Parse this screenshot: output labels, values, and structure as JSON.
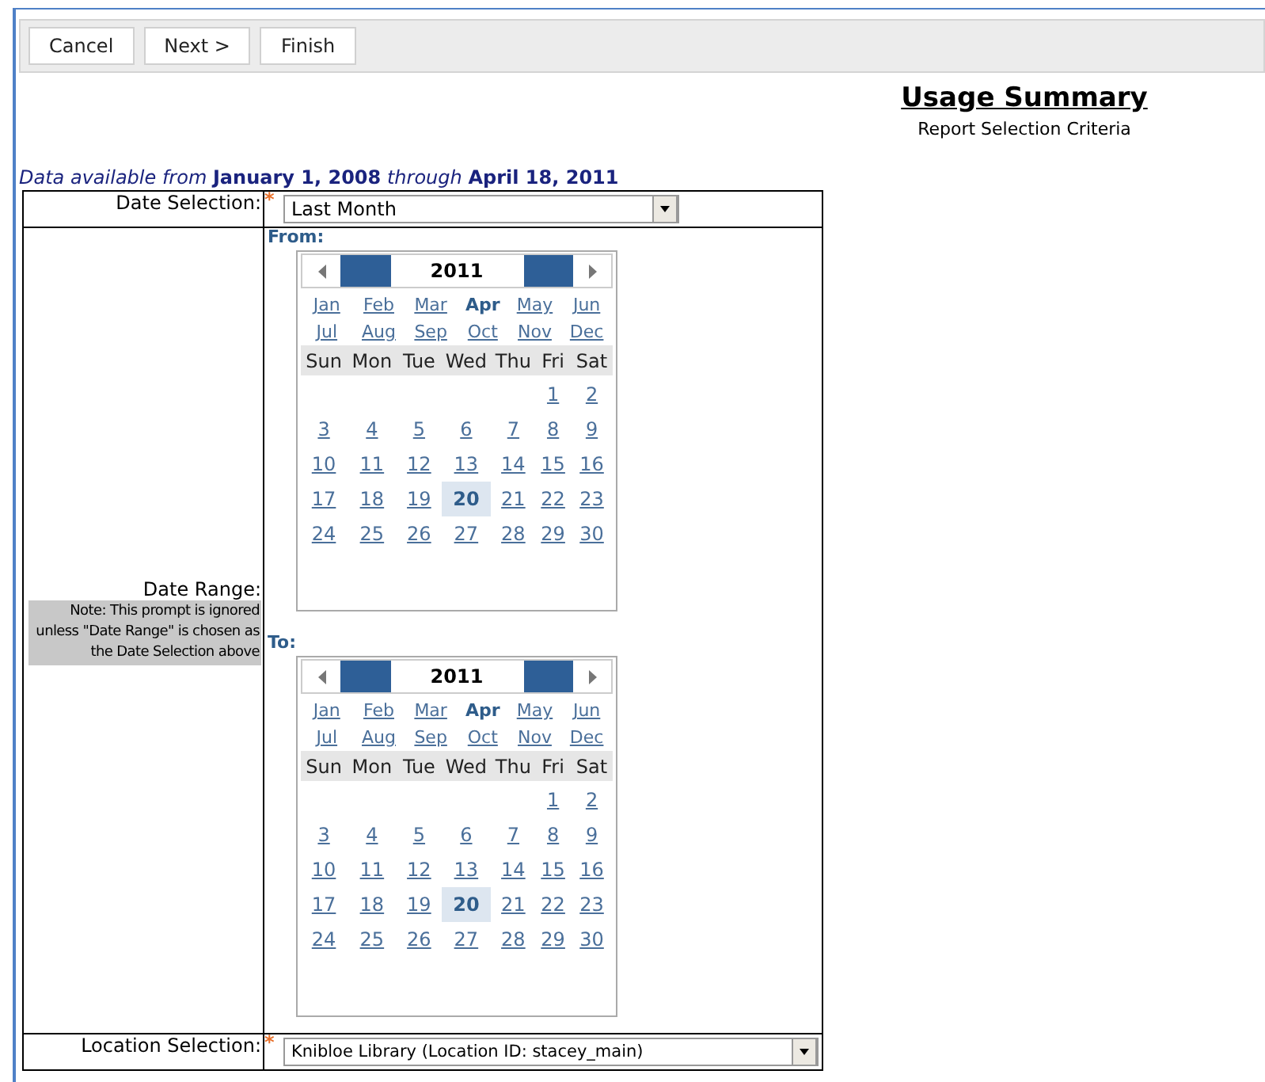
{
  "toolbar": {
    "buttons": [
      "Cancel",
      "Next >",
      "Finish"
    ]
  },
  "header": {
    "title": "Usage Summary",
    "subtitle": "Report Selection Criteria"
  },
  "availability": {
    "prefix": "Data available from",
    "start": "January 1, 2008",
    "middle": "through",
    "end": "April 18, 2011"
  },
  "date_selection": {
    "label": "Date Selection:",
    "required": "*",
    "value": "Last Month"
  },
  "date_range": {
    "label": "Date Range:",
    "note": "Note: This prompt is ignored unless \"Date Range\" is chosen as the Date Selection above",
    "calendars": [
      {
        "label": "From:",
        "year": "2011",
        "months": [
          {
            "label": "Jan",
            "selected": false
          },
          {
            "label": "Feb",
            "selected": false
          },
          {
            "label": "Mar",
            "selected": false
          },
          {
            "label": "Apr",
            "selected": true
          },
          {
            "label": "May",
            "selected": false
          },
          {
            "label": "Jun",
            "selected": false
          },
          {
            "label": "Jul",
            "selected": false
          },
          {
            "label": "Aug",
            "selected": false
          },
          {
            "label": "Sep",
            "selected": false
          },
          {
            "label": "Oct",
            "selected": false
          },
          {
            "label": "Nov",
            "selected": false
          },
          {
            "label": "Dec",
            "selected": false
          }
        ],
        "weekdays": [
          "Sun",
          "Mon",
          "Tue",
          "Wed",
          "Thu",
          "Fri",
          "Sat"
        ],
        "weeks": [
          [
            {
              "day": "1",
              "selected": false
            },
            {
              "day": "2",
              "selected": false
            }
          ],
          [
            {
              "day": "3",
              "selected": false
            },
            {
              "day": "4",
              "selected": false
            },
            {
              "day": "5",
              "selected": false
            },
            {
              "day": "6",
              "selected": false
            },
            {
              "day": "7",
              "selected": false
            },
            {
              "day": "8",
              "selected": false
            },
            {
              "day": "9",
              "selected": false
            }
          ],
          [
            {
              "day": "10",
              "selected": false
            },
            {
              "day": "11",
              "selected": false
            },
            {
              "day": "12",
              "selected": false
            },
            {
              "day": "13",
              "selected": false
            },
            {
              "day": "14",
              "selected": false
            },
            {
              "day": "15",
              "selected": false
            },
            {
              "day": "16",
              "selected": false
            }
          ],
          [
            {
              "day": "17",
              "selected": false
            },
            {
              "day": "18",
              "selected": false
            },
            {
              "day": "19",
              "selected": false
            },
            {
              "day": "20",
              "selected": true
            },
            {
              "day": "21",
              "selected": false
            },
            {
              "day": "22",
              "selected": false
            },
            {
              "day": "23",
              "selected": false
            }
          ],
          [
            {
              "day": "24",
              "selected": false
            },
            {
              "day": "25",
              "selected": false
            },
            {
              "day": "26",
              "selected": false
            },
            {
              "day": "27",
              "selected": false
            },
            {
              "day": "28",
              "selected": false
            },
            {
              "day": "29",
              "selected": false
            },
            {
              "day": "30",
              "selected": false
            }
          ]
        ]
      },
      {
        "label": "To:",
        "year": "2011",
        "months": [
          {
            "label": "Jan",
            "selected": false
          },
          {
            "label": "Feb",
            "selected": false
          },
          {
            "label": "Mar",
            "selected": false
          },
          {
            "label": "Apr",
            "selected": true
          },
          {
            "label": "May",
            "selected": false
          },
          {
            "label": "Jun",
            "selected": false
          },
          {
            "label": "Jul",
            "selected": false
          },
          {
            "label": "Aug",
            "selected": false
          },
          {
            "label": "Sep",
            "selected": false
          },
          {
            "label": "Oct",
            "selected": false
          },
          {
            "label": "Nov",
            "selected": false
          },
          {
            "label": "Dec",
            "selected": false
          }
        ],
        "weekdays": [
          "Sun",
          "Mon",
          "Tue",
          "Wed",
          "Thu",
          "Fri",
          "Sat"
        ],
        "weeks": [
          [
            {
              "day": "1",
              "selected": false
            },
            {
              "day": "2",
              "selected": false
            }
          ],
          [
            {
              "day": "3",
              "selected": false
            },
            {
              "day": "4",
              "selected": false
            },
            {
              "day": "5",
              "selected": false
            },
            {
              "day": "6",
              "selected": false
            },
            {
              "day": "7",
              "selected": false
            },
            {
              "day": "8",
              "selected": false
            },
            {
              "day": "9",
              "selected": false
            }
          ],
          [
            {
              "day": "10",
              "selected": false
            },
            {
              "day": "11",
              "selected": false
            },
            {
              "day": "12",
              "selected": false
            },
            {
              "day": "13",
              "selected": false
            },
            {
              "day": "14",
              "selected": false
            },
            {
              "day": "15",
              "selected": false
            },
            {
              "day": "16",
              "selected": false
            }
          ],
          [
            {
              "day": "17",
              "selected": false
            },
            {
              "day": "18",
              "selected": false
            },
            {
              "day": "19",
              "selected": false
            },
            {
              "day": "20",
              "selected": true
            },
            {
              "day": "21",
              "selected": false
            },
            {
              "day": "22",
              "selected": false
            },
            {
              "day": "23",
              "selected": false
            }
          ],
          [
            {
              "day": "24",
              "selected": false
            },
            {
              "day": "25",
              "selected": false
            },
            {
              "day": "26",
              "selected": false
            },
            {
              "day": "27",
              "selected": false
            },
            {
              "day": "28",
              "selected": false
            },
            {
              "day": "29",
              "selected": false
            },
            {
              "day": "30",
              "selected": false
            }
          ]
        ]
      }
    ]
  },
  "location_selection": {
    "label": "Location Selection:",
    "required": "*",
    "value": "Knibloe Library (Location ID: stacey_main)"
  }
}
